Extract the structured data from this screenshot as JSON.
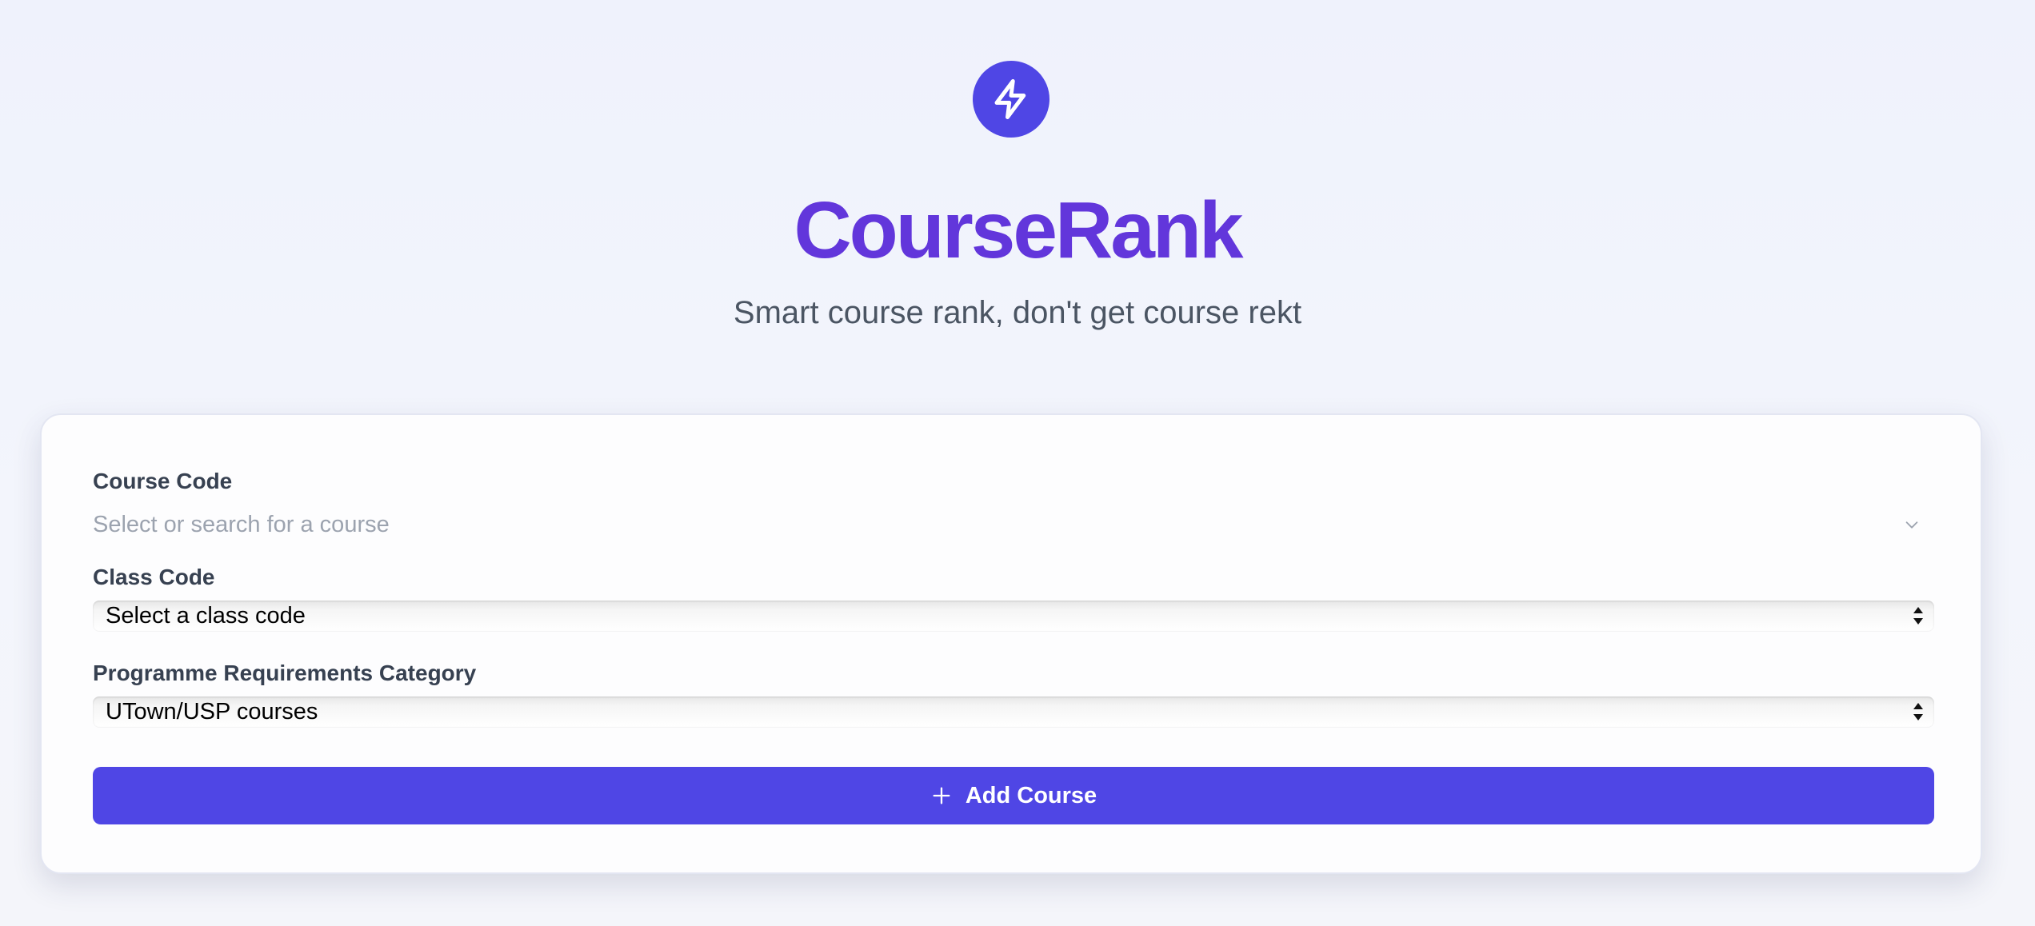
{
  "header": {
    "logo_icon": "lightning-bolt-icon",
    "title": "CourseRank",
    "subtitle": "Smart course rank, don't get course rekt"
  },
  "form": {
    "course_code": {
      "label": "Course Code",
      "placeholder": "Select or search for a course",
      "icon": "chevron-down-icon"
    },
    "class_code": {
      "label": "Class Code",
      "selected": "Select a class code"
    },
    "category": {
      "label": "Programme Requirements Category",
      "selected": "UTown/USP courses"
    },
    "add_button": {
      "icon": "plus-icon",
      "label": "Add Course"
    }
  },
  "colors": {
    "accent": "#4f46e5",
    "title": "#6236db",
    "background": "#eff2fc"
  }
}
